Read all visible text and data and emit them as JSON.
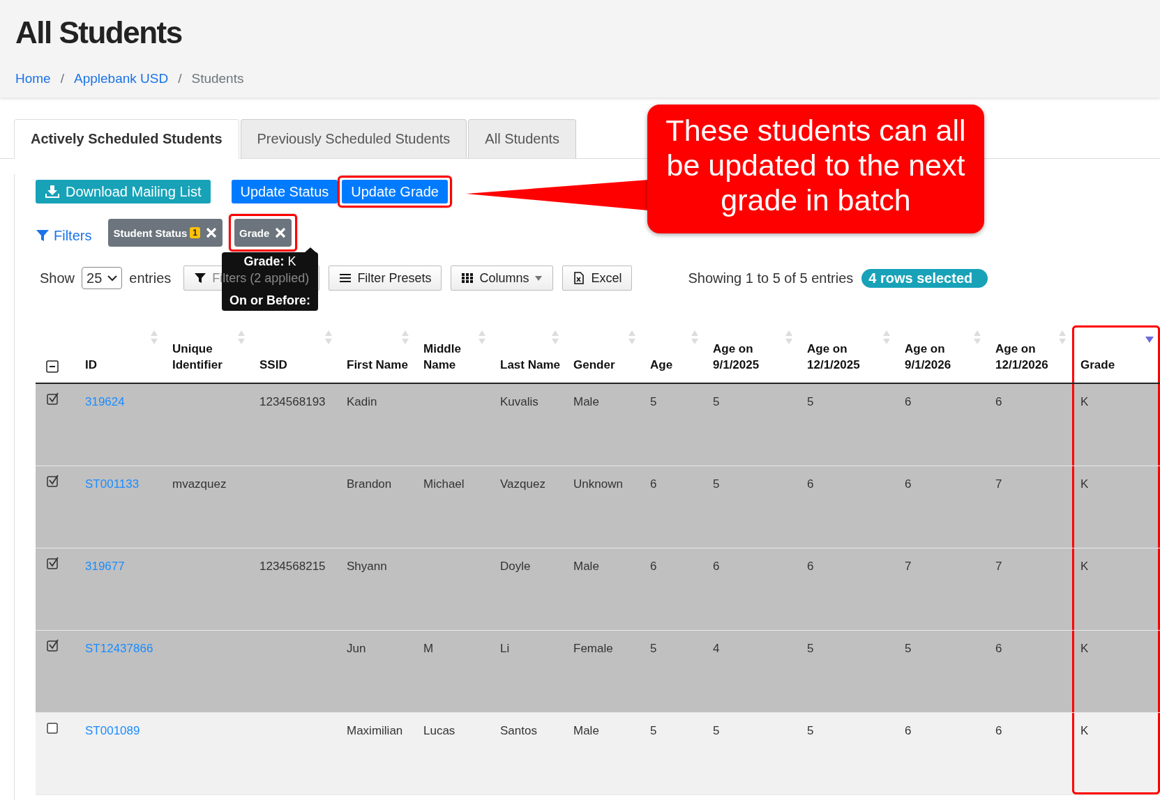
{
  "header": {
    "title": "All Students",
    "breadcrumb": [
      {
        "kind": "link",
        "label": "Home"
      },
      {
        "kind": "separator",
        "label": "/"
      },
      {
        "kind": "link",
        "label": "Applebank USD"
      },
      {
        "kind": "separator",
        "label": "/"
      },
      {
        "kind": "current",
        "label": "Students"
      }
    ]
  },
  "tabs": [
    {
      "label": "Actively Scheduled Students",
      "selected": true
    },
    {
      "label": "Previously Scheduled Students",
      "selected": false
    },
    {
      "label": "All Students",
      "selected": false
    }
  ],
  "actions": [
    {
      "kind": "download",
      "label": "Download Mailing List",
      "highlighted": false
    },
    {
      "kind": "primary",
      "label": "Update Status",
      "highlighted": false
    },
    {
      "kind": "primary",
      "label": "Update Grade",
      "highlighted": true
    }
  ],
  "filters": {
    "label": "Filters",
    "chips": [
      {
        "label": "Student Status",
        "badge": "1",
        "highlighted": false
      },
      {
        "label": "Grade",
        "highlighted": true
      }
    ]
  },
  "tooltip": {
    "lines": [
      {
        "label": "Grade:",
        "value": "K"
      },
      {
        "label": "On or Before:"
      }
    ]
  },
  "toolbar": {
    "show_label": "Show",
    "page_size": "25",
    "entries_label": "entries",
    "buttons": [
      {
        "kind": "filter",
        "label": "Filters (2 applied)"
      },
      {
        "kind": "list",
        "label": "Filter Presets"
      },
      {
        "kind": "grid",
        "label": "Columns",
        "caret": true
      },
      {
        "kind": "excel",
        "label": "Excel"
      }
    ],
    "info": "Showing 1 to 5 of 5 entries",
    "selected_badge": "4 rows selected"
  },
  "table": {
    "select_all_partial": true,
    "columns": [
      {
        "label": "ID",
        "sorted_descending": false,
        "highlighted": false
      },
      {
        "label": "Unique Identifier",
        "sorted_descending": false,
        "highlighted": false
      },
      {
        "label": "SSID",
        "sorted_descending": false,
        "highlighted": false
      },
      {
        "label": "First Name",
        "sorted_descending": false,
        "highlighted": false
      },
      {
        "label": "Middle Name",
        "sorted_descending": false,
        "highlighted": false
      },
      {
        "label": "Last Name",
        "sorted_descending": false,
        "highlighted": false
      },
      {
        "label": "Gender",
        "sorted_descending": false,
        "highlighted": false
      },
      {
        "label": "Age",
        "sorted_descending": false,
        "highlighted": false
      },
      {
        "label": "Age on 9/1/2025",
        "sorted_descending": false,
        "highlighted": false
      },
      {
        "label": "Age on 12/1/2025",
        "sorted_descending": false,
        "highlighted": false
      },
      {
        "label": "Age on 9/1/2026",
        "sorted_descending": false,
        "highlighted": false
      },
      {
        "label": "Age on 12/1/2026",
        "sorted_descending": false,
        "highlighted": false
      },
      {
        "label": "Grade",
        "sorted_descending": true,
        "highlighted": true
      }
    ],
    "rows": [
      {
        "selected": true,
        "cells": [
          "319624",
          "",
          "1234568193",
          "Kadin",
          "",
          "Kuvalis",
          "Male",
          "5",
          "5",
          "5",
          "6",
          "6",
          "K"
        ]
      },
      {
        "selected": true,
        "cells": [
          "ST001133",
          "mvazquez",
          "",
          "Brandon",
          "Michael",
          "Vazquez",
          "Unknown",
          "6",
          "5",
          "6",
          "6",
          "7",
          "K"
        ]
      },
      {
        "selected": true,
        "cells": [
          "319677",
          "",
          "1234568215",
          "Shyann",
          "",
          "Doyle",
          "Male",
          "6",
          "6",
          "6",
          "7",
          "7",
          "K"
        ]
      },
      {
        "selected": true,
        "cells": [
          "ST12437866",
          "",
          "",
          "Jun",
          "M",
          "Li",
          "Female",
          "5",
          "4",
          "5",
          "5",
          "6",
          "K"
        ]
      },
      {
        "selected": false,
        "cells": [
          "ST001089",
          "",
          "",
          "Maximilian",
          "Lucas",
          "Santos",
          "Male",
          "5",
          "5",
          "5",
          "6",
          "6",
          "K"
        ]
      }
    ]
  },
  "callout": {
    "text": "These students can all be updated to the next grade in batch"
  }
}
